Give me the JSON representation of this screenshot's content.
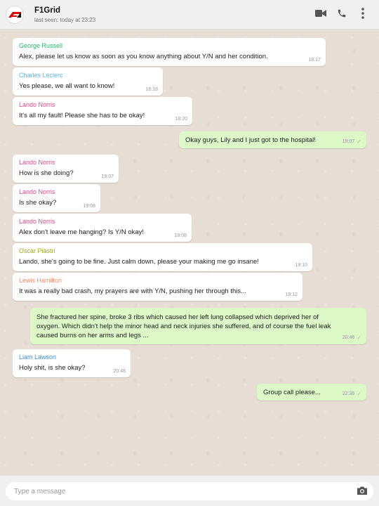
{
  "header": {
    "title": "F1Grid",
    "subtitle": "last seen: today at 23:23"
  },
  "icons": {
    "avatar": "f1-logo-icon",
    "video": "video-camera-icon",
    "call": "phone-icon",
    "menu": "kebab-menu-icon",
    "camera": "camera-icon"
  },
  "colors": {
    "george": "#2bb66a",
    "charles": "#5bb8e8",
    "lando": "#e0458e",
    "oscar": "#9aaa20",
    "lewis": "#ee8d6a",
    "liam": "#3a8fd6",
    "outgoing_bubble": "#dcf8c6",
    "incoming_bubble": "#ffffff"
  },
  "messages": [
    {
      "sender": "George Russell",
      "text": "Alex, please let us know as soon as you know anything about Y/N and her condition.",
      "time": "18:17"
    },
    {
      "sender": "Charles Leclerc",
      "text": "Yes please, we all want to know!",
      "time": "18:18"
    },
    {
      "sender": "Lando Norris",
      "text": "It's all my fault! Please she has to be okay!",
      "time": "18:20"
    },
    {
      "sender": "",
      "text": "Okay guys, Lily and I just got to the hospital!",
      "time": "19:07"
    },
    {
      "sender": "Lando Norris",
      "text": "How is she doing?",
      "time": "19:07"
    },
    {
      "sender": "Lando Norris",
      "text": "Is she okay?",
      "time": "19:08"
    },
    {
      "sender": "Lando Norris",
      "text": "Alex don't leave me hanging? Is Y/N okay!",
      "time": "19:08"
    },
    {
      "sender": "Oscar Piastri",
      "text": "Lando, she's going to be fine. Just calm down, please your making me go insane!",
      "time": "19:10"
    },
    {
      "sender": "Lewis Hamilton",
      "text": "It was a really bad crash, my prayers are with Y/N, pushing her through this...",
      "time": "19:12"
    },
    {
      "sender": "",
      "text": "She fractured her spine, broke 3 ribs which caused her left lung collapsed which deprived her of oxygen. Which didn't help the minor head and neck injuries she suffered, and of course the fuel leak caused burns on her arms and legs ...",
      "time": "20:46"
    },
    {
      "sender": "Liam Lawson",
      "text": "Holy shit, is she okay?",
      "time": "20:48"
    },
    {
      "sender": "",
      "text": "Group call please...",
      "time": "22:36"
    }
  ],
  "composer": {
    "placeholder": "Type a message"
  }
}
